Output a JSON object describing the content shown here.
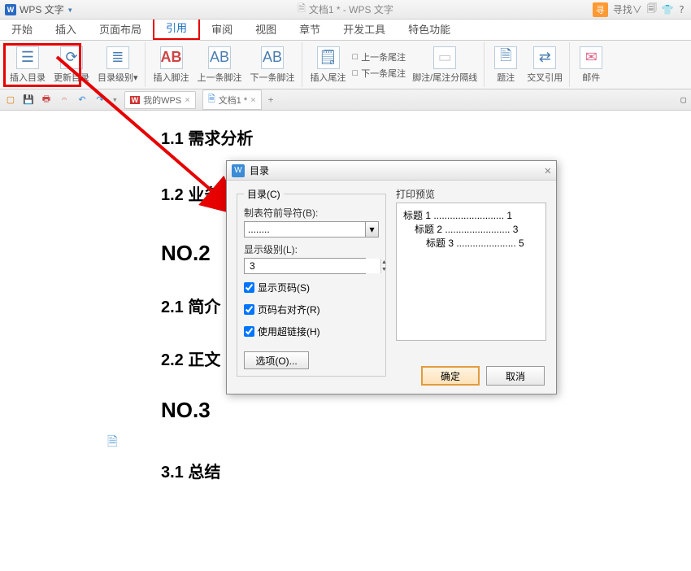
{
  "titlebar": {
    "app_name": "WPS 文字",
    "doc_name": "文档1 * - WPS 文字",
    "search_label": "寻",
    "search_text": "寻找∨"
  },
  "menu": {
    "tabs": [
      "开始",
      "插入",
      "页面布局",
      "引用",
      "审阅",
      "视图",
      "章节",
      "开发工具",
      "特色功能"
    ],
    "active": "引用"
  },
  "ribbon": {
    "insert_toc": "插入目录",
    "update_toc": "更新目录",
    "toc_level": "目录级别",
    "insert_footnote": "插入脚注",
    "prev_footnote": "上一条脚注",
    "next_footnote": "下一条脚注",
    "insert_endnote": "插入尾注",
    "prev_endnote": "上一条尾注",
    "next_endnote": "下一条尾注",
    "separator": "脚注/尾注分隔线",
    "caption": "题注",
    "crossref": "交叉引用",
    "mail": "邮件"
  },
  "qbar": {
    "wps_tab": "我的WPS",
    "doc_tab": "文档1 *"
  },
  "document": {
    "h11": "1.1 需求分析",
    "h12": "1.2 业务",
    "no2": "NO.2",
    "h21": "2.1 简介",
    "h22": "2.2 正文",
    "no3": "NO.3",
    "h31": "3.1 总结"
  },
  "dialog": {
    "title": "目录",
    "fieldset_legend": "目录(C)",
    "leader_label": "制表符前导符(B):",
    "leader_value": "........",
    "level_label": "显示级别(L):",
    "level_value": "3",
    "show_page": "显示页码(S)",
    "right_align": "页码右对齐(R)",
    "hyperlink": "使用超链接(H)",
    "options_btn": "选项(O)...",
    "preview_label": "打印预览",
    "preview": {
      "l1_left": "标题 1",
      "l1_right": "1",
      "l2_left": "标题 2",
      "l2_right": "3",
      "l3_left": "标题 3",
      "l3_right": "5"
    },
    "ok": "确定",
    "cancel": "取消"
  }
}
